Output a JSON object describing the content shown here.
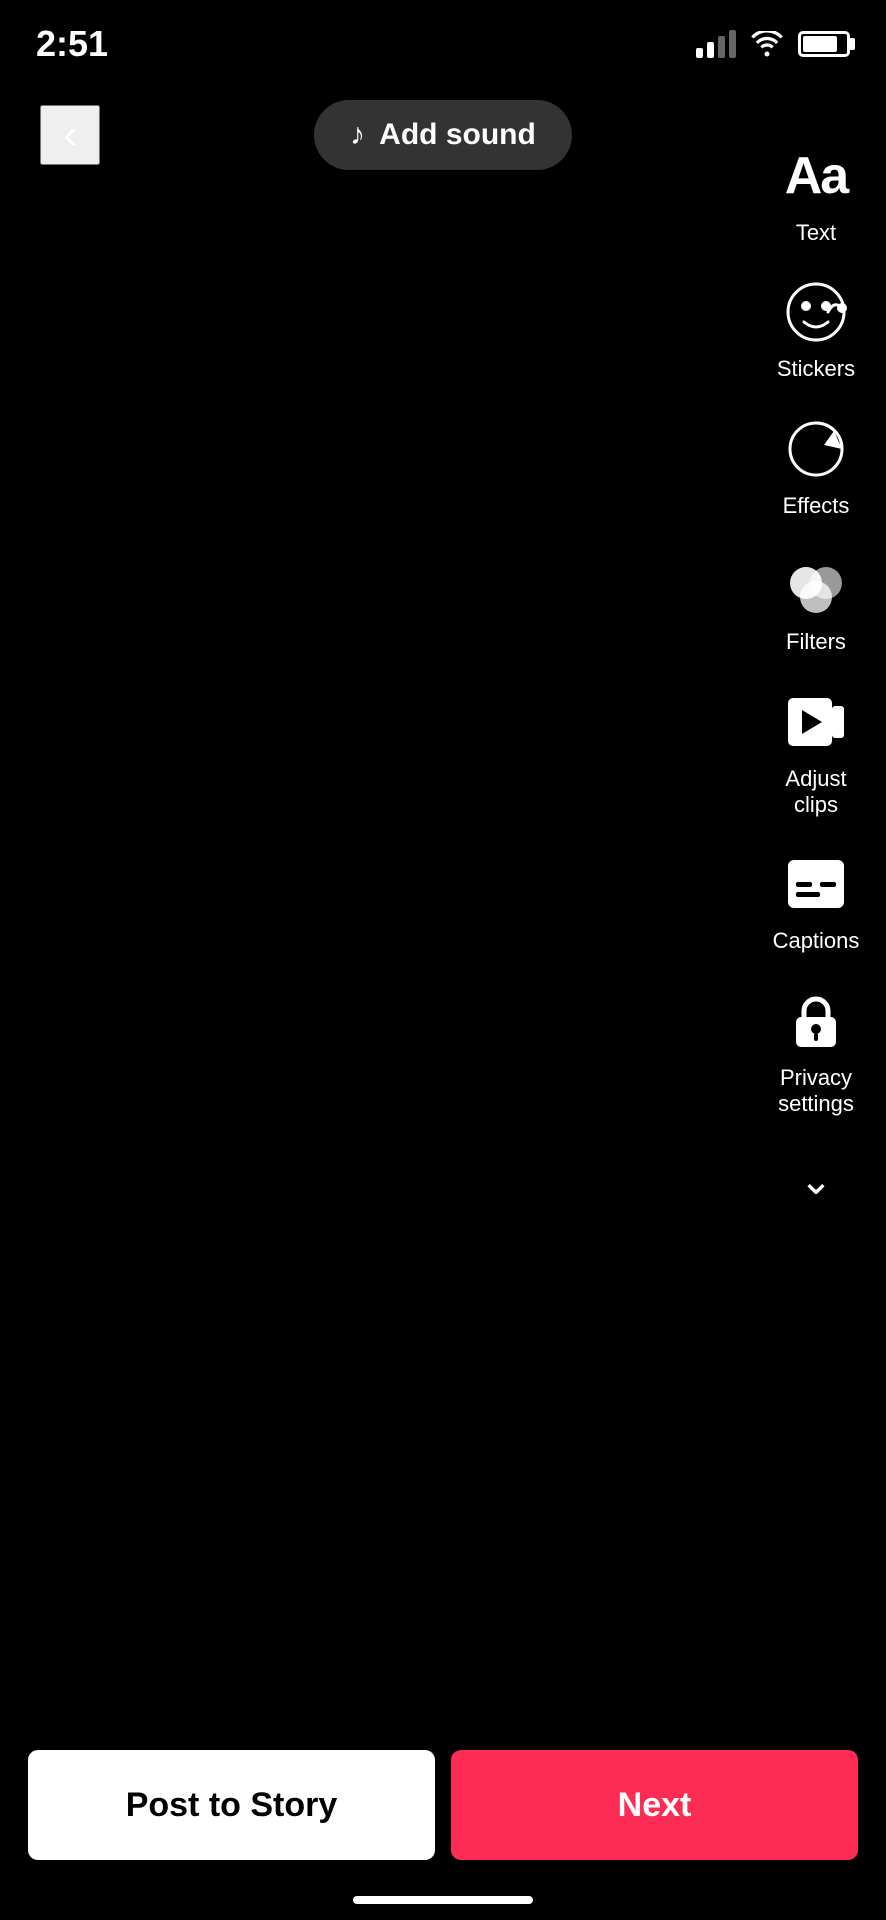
{
  "statusBar": {
    "time": "2:51",
    "batteryLevel": 80
  },
  "topBar": {
    "backLabel": "<",
    "addSoundLabel": "Add sound"
  },
  "tools": [
    {
      "id": "text",
      "label": "Text",
      "iconType": "text"
    },
    {
      "id": "stickers",
      "label": "Stickers",
      "iconType": "sticker"
    },
    {
      "id": "effects",
      "label": "Effects",
      "iconType": "effects"
    },
    {
      "id": "filters",
      "label": "Filters",
      "iconType": "filters"
    },
    {
      "id": "adjust-clips",
      "label": "Adjust clips",
      "iconType": "adjust"
    },
    {
      "id": "captions",
      "label": "Captions",
      "iconType": "captions"
    },
    {
      "id": "privacy-settings",
      "label": "Privacy settings",
      "iconType": "privacy"
    }
  ],
  "bottomBar": {
    "postStoryLabel": "Post to Story",
    "nextLabel": "Next"
  }
}
